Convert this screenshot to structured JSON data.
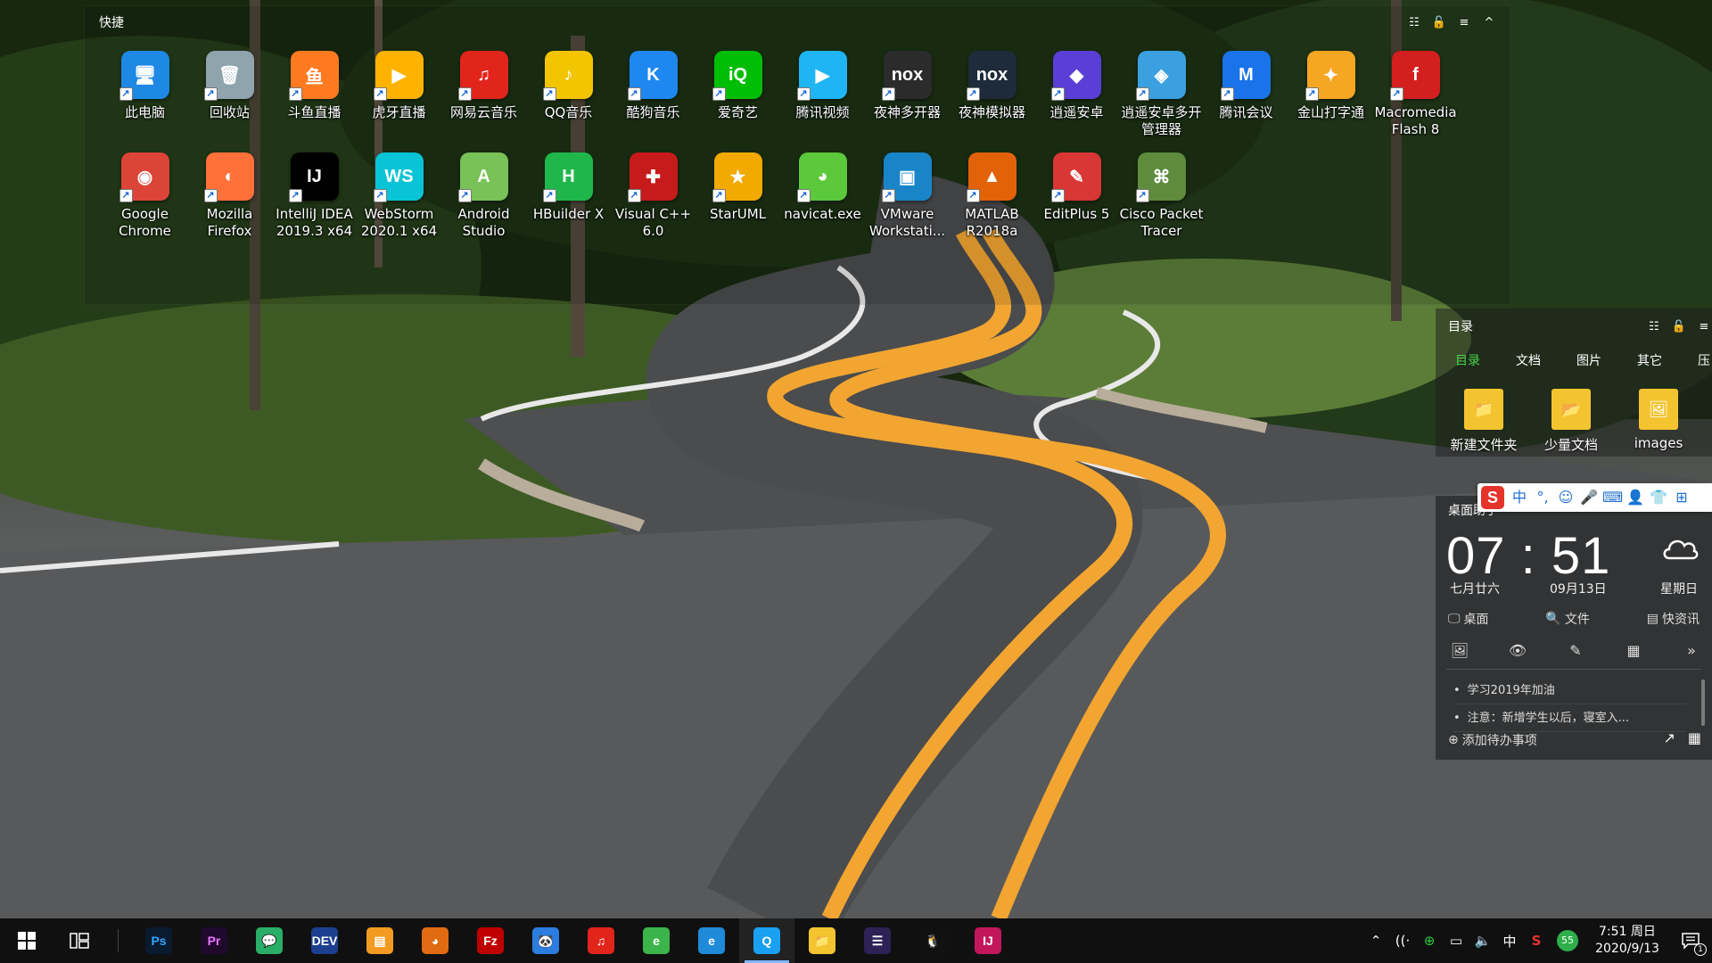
{
  "fence_quick": {
    "title": "快捷",
    "icons": [
      {
        "label": "此电脑",
        "glyph": "🖥",
        "color": "#1e88e5"
      },
      {
        "label": "回收站",
        "glyph": "🗑",
        "color": "#90a4ae"
      },
      {
        "label": "斗鱼直播",
        "glyph": "鱼",
        "color": "#ff7a21"
      },
      {
        "label": "虎牙直播",
        "glyph": "▶",
        "color": "#ffb300"
      },
      {
        "label": "网易云音乐",
        "glyph": "♫",
        "color": "#e1251b"
      },
      {
        "label": "QQ音乐",
        "glyph": "♪",
        "color": "#f3c400"
      },
      {
        "label": "酷狗音乐",
        "glyph": "K",
        "color": "#1e88f0"
      },
      {
        "label": "爱奇艺",
        "glyph": "iQ",
        "color": "#00be06"
      },
      {
        "label": "腾讯视频",
        "glyph": "▶",
        "color": "#1fb5f4"
      },
      {
        "label": "夜神多开器",
        "glyph": "nox",
        "color": "#2b2b2b"
      },
      {
        "label": "夜神模拟器",
        "glyph": "nox",
        "color": "#1d2b3a"
      },
      {
        "label": "逍遥安卓",
        "glyph": "◆",
        "color": "#5a3fd6"
      },
      {
        "label": "逍遥安卓多开管理器",
        "glyph": "◈",
        "color": "#3aa0e0"
      },
      {
        "label": "腾讯会议",
        "glyph": "M",
        "color": "#1a73e8"
      },
      {
        "label": "金山打字通",
        "glyph": "✦",
        "color": "#f5a623"
      },
      {
        "label": "Macromedia Flash 8",
        "glyph": "f",
        "color": "#d41f1f"
      },
      {
        "label": "Google Chrome",
        "glyph": "◉",
        "color": "#db4437"
      },
      {
        "label": "Mozilla Firefox",
        "glyph": "◐",
        "color": "#ff7139"
      },
      {
        "label": "IntelliJ IDEA 2019.3 x64",
        "glyph": "IJ",
        "color": "#000000"
      },
      {
        "label": "WebStorm 2020.1 x64",
        "glyph": "WS",
        "color": "#08c4d6"
      },
      {
        "label": "Android Studio",
        "glyph": "A",
        "color": "#78c257"
      },
      {
        "label": "HBuilder X",
        "glyph": "H",
        "color": "#1fb74b"
      },
      {
        "label": "Visual C++ 6.0",
        "glyph": "✚",
        "color": "#c71b1b"
      },
      {
        "label": "StarUML",
        "glyph": "★",
        "color": "#f2a900"
      },
      {
        "label": "navicat.exe",
        "glyph": "◕",
        "color": "#5cc83b"
      },
      {
        "label": "VMware Workstati...",
        "glyph": "▣",
        "color": "#1985c8"
      },
      {
        "label": "MATLAB R2018a",
        "glyph": "▲",
        "color": "#e2620a"
      },
      {
        "label": "EditPlus 5",
        "glyph": "✎",
        "color": "#d93636"
      },
      {
        "label": "Cisco Packet Tracer",
        "glyph": "⌘",
        "color": "#5e8c3c"
      }
    ]
  },
  "fence_dir": {
    "title": "目录",
    "tabs": [
      {
        "label": "目录",
        "active": true
      },
      {
        "label": "文档",
        "active": false
      },
      {
        "label": "图片",
        "active": false
      },
      {
        "label": "其它",
        "active": false
      },
      {
        "label": "压",
        "active": false
      }
    ],
    "items": [
      {
        "label": "新建文件夹",
        "glyph": "📁",
        "color": "#f4c430"
      },
      {
        "label": "少量文档",
        "glyph": "📂",
        "color": "#f4c430"
      },
      {
        "label": "images",
        "glyph": "🖼",
        "color": "#f4c430"
      }
    ]
  },
  "ime": {
    "logo": "S",
    "buttons": [
      "中",
      "°,",
      "☺",
      "🎤",
      "⌨",
      "👤",
      "👕",
      "⊞"
    ]
  },
  "assistant": {
    "title": "桌面助手",
    "time": "07 : 51",
    "lunar": "七月廿六",
    "date": "09月13日",
    "weekday": "星期日",
    "tabs": [
      {
        "icon": "🖵",
        "label": "桌面"
      },
      {
        "icon": "🔍",
        "label": "文件"
      },
      {
        "icon": "▤",
        "label": "快资讯"
      }
    ],
    "tools": [
      "🖼",
      "👁",
      "✎",
      "▦",
      "»"
    ],
    "todos": [
      "学习2019年加油",
      "注意：新增学生以后，寝室入..."
    ],
    "add_todo": "添加待办事项"
  },
  "taskbar": {
    "apps": [
      {
        "name": "photoshop",
        "glyph": "Ps",
        "color": "#0a1a2f",
        "fg": "#31a8ff"
      },
      {
        "name": "premiere",
        "glyph": "Pr",
        "color": "#1f0a2e",
        "fg": "#ea77ff"
      },
      {
        "name": "wechat",
        "glyph": "💬",
        "color": "#2aae67",
        "fg": "#fff"
      },
      {
        "name": "devcpp",
        "glyph": "DEV",
        "color": "#1c3f8f",
        "fg": "#fff"
      },
      {
        "name": "sublime",
        "glyph": "▤",
        "color": "#f29b20",
        "fg": "#fff"
      },
      {
        "name": "monkey",
        "glyph": "◕",
        "color": "#e06b12",
        "fg": "#fff"
      },
      {
        "name": "filezilla",
        "glyph": "Fz",
        "color": "#bf0000",
        "fg": "#fff"
      },
      {
        "name": "panda",
        "glyph": "🐼",
        "color": "#2b7de0",
        "fg": "#fff"
      },
      {
        "name": "netease-music",
        "glyph": "♫",
        "color": "#e1251b",
        "fg": "#fff"
      },
      {
        "name": "browser-green",
        "glyph": "e",
        "color": "#3bb44a",
        "fg": "#fff"
      },
      {
        "name": "ie",
        "glyph": "e",
        "color": "#1e8ad8",
        "fg": "#fff"
      },
      {
        "name": "qq-browser",
        "glyph": "Q",
        "color": "#1aa0f0",
        "fg": "#fff",
        "active": true
      },
      {
        "name": "file-explorer",
        "glyph": "📁",
        "color": "#f4c430",
        "fg": "#fff"
      },
      {
        "name": "eclipse",
        "glyph": "☰",
        "color": "#2c2255",
        "fg": "#fff"
      },
      {
        "name": "qq",
        "glyph": "🐧",
        "color": "#111",
        "fg": "#fff"
      },
      {
        "name": "intellij",
        "glyph": "IJ",
        "color": "#c2185b",
        "fg": "#fff"
      }
    ],
    "tray": {
      "ime_lang": "中",
      "battery_badge": "55",
      "time": "7:51 周日",
      "date": "2020/9/13",
      "notification_count": "1"
    }
  }
}
